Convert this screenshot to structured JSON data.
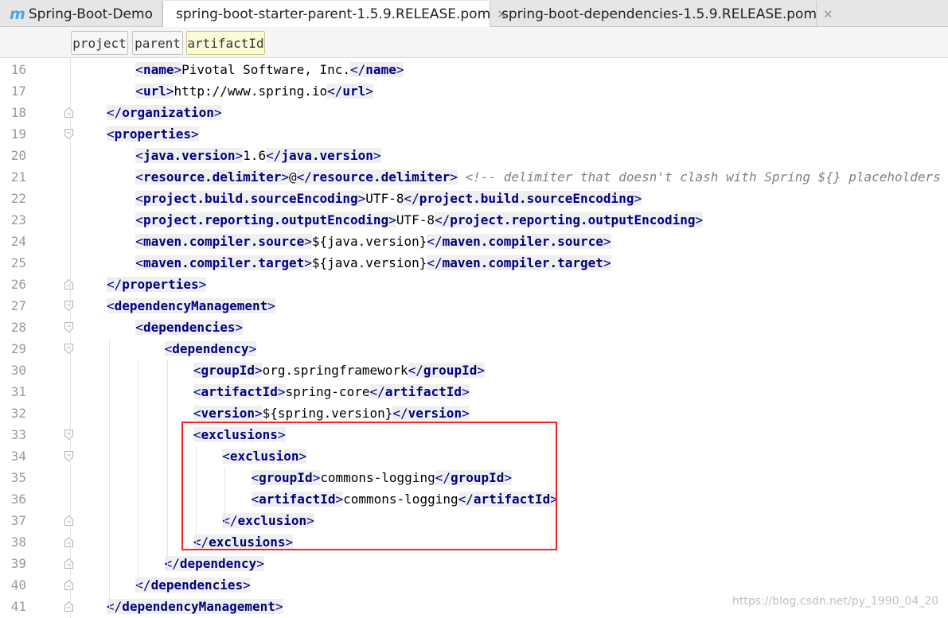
{
  "tabs": [
    {
      "label": "Spring-Boot-Demo",
      "icon": "maven-module-icon",
      "active": false
    },
    {
      "label": "spring-boot-starter-parent-1.5.9.RELEASE.pom",
      "icon": "pom-file-icon",
      "active": true
    },
    {
      "label": "spring-boot-dependencies-1.5.9.RELEASE.pom",
      "icon": "pom-file-icon",
      "active": false
    }
  ],
  "breadcrumb": [
    "project",
    "parent",
    "artifactId"
  ],
  "lines": [
    {
      "num": "16",
      "indent": 2,
      "fold": "",
      "tokens": [
        [
          "o",
          "<"
        ],
        [
          "t",
          "name"
        ],
        [
          "o",
          ">"
        ],
        [
          "x",
          "Pivotal Software, Inc."
        ],
        [
          "o",
          "</"
        ],
        [
          "t",
          "name"
        ],
        [
          "o",
          ">"
        ]
      ]
    },
    {
      "num": "17",
      "indent": 2,
      "fold": "",
      "tokens": [
        [
          "o",
          "<"
        ],
        [
          "t",
          "url"
        ],
        [
          "o",
          ">"
        ],
        [
          "x",
          "http://www.spring.io"
        ],
        [
          "o",
          "</"
        ],
        [
          "t",
          "url"
        ],
        [
          "o",
          ">"
        ]
      ]
    },
    {
      "num": "18",
      "indent": 1,
      "fold": "end",
      "tokens": [
        [
          "o",
          "</"
        ],
        [
          "t",
          "organization"
        ],
        [
          "o",
          ">"
        ]
      ]
    },
    {
      "num": "19",
      "indent": 1,
      "fold": "start",
      "tokens": [
        [
          "o",
          "<"
        ],
        [
          "t",
          "properties"
        ],
        [
          "o",
          ">"
        ]
      ]
    },
    {
      "num": "20",
      "indent": 2,
      "fold": "",
      "tokens": [
        [
          "o",
          "<"
        ],
        [
          "t",
          "java.version"
        ],
        [
          "o",
          ">"
        ],
        [
          "x",
          "1.6"
        ],
        [
          "o",
          "</"
        ],
        [
          "t",
          "java.version"
        ],
        [
          "o",
          ">"
        ]
      ]
    },
    {
      "num": "21",
      "indent": 2,
      "fold": "",
      "tokens": [
        [
          "o",
          "<"
        ],
        [
          "t",
          "resource.delimiter"
        ],
        [
          "o",
          ">"
        ],
        [
          "x",
          "@"
        ],
        [
          "o",
          "</"
        ],
        [
          "t",
          "resource.delimiter"
        ],
        [
          "o",
          ">"
        ],
        [
          "s",
          " "
        ],
        [
          "c",
          "<!-- delimiter that doesn't clash with Spring ${} placeholders -->"
        ]
      ]
    },
    {
      "num": "22",
      "indent": 2,
      "fold": "",
      "tokens": [
        [
          "o",
          "<"
        ],
        [
          "t",
          "project.build.sourceEncoding"
        ],
        [
          "o",
          ">"
        ],
        [
          "x",
          "UTF-8"
        ],
        [
          "o",
          "</"
        ],
        [
          "t",
          "project.build.sourceEncoding"
        ],
        [
          "o",
          ">"
        ]
      ]
    },
    {
      "num": "23",
      "indent": 2,
      "fold": "",
      "tokens": [
        [
          "o",
          "<"
        ],
        [
          "t",
          "project.reporting.outputEncoding"
        ],
        [
          "o",
          ">"
        ],
        [
          "x",
          "UTF-8"
        ],
        [
          "o",
          "</"
        ],
        [
          "t",
          "project.reporting.outputEncoding"
        ],
        [
          "o",
          ">"
        ]
      ]
    },
    {
      "num": "24",
      "indent": 2,
      "fold": "",
      "tokens": [
        [
          "o",
          "<"
        ],
        [
          "t",
          "maven.compiler.source"
        ],
        [
          "o",
          ">"
        ],
        [
          "x",
          "${java.version}"
        ],
        [
          "o",
          "</"
        ],
        [
          "t",
          "maven.compiler.source"
        ],
        [
          "o",
          ">"
        ]
      ]
    },
    {
      "num": "25",
      "indent": 2,
      "fold": "",
      "tokens": [
        [
          "o",
          "<"
        ],
        [
          "t",
          "maven.compiler.target"
        ],
        [
          "o",
          ">"
        ],
        [
          "x",
          "${java.version}"
        ],
        [
          "o",
          "</"
        ],
        [
          "t",
          "maven.compiler.target"
        ],
        [
          "o",
          ">"
        ]
      ]
    },
    {
      "num": "26",
      "indent": 1,
      "fold": "end",
      "tokens": [
        [
          "o",
          "</"
        ],
        [
          "t",
          "properties"
        ],
        [
          "o",
          ">"
        ]
      ]
    },
    {
      "num": "27",
      "indent": 1,
      "fold": "start",
      "tokens": [
        [
          "o",
          "<"
        ],
        [
          "t",
          "dependencyManagement"
        ],
        [
          "o",
          ">"
        ]
      ]
    },
    {
      "num": "28",
      "indent": 2,
      "fold": "start",
      "tokens": [
        [
          "o",
          "<"
        ],
        [
          "t",
          "dependencies"
        ],
        [
          "o",
          ">"
        ]
      ]
    },
    {
      "num": "29",
      "indent": 3,
      "fold": "start",
      "tokens": [
        [
          "o",
          "<"
        ],
        [
          "t",
          "dependency"
        ],
        [
          "o",
          ">"
        ]
      ]
    },
    {
      "num": "30",
      "indent": 4,
      "fold": "",
      "tokens": [
        [
          "o",
          "<"
        ],
        [
          "t",
          "groupId"
        ],
        [
          "o",
          ">"
        ],
        [
          "x",
          "org.springframework"
        ],
        [
          "o",
          "</"
        ],
        [
          "t",
          "groupId"
        ],
        [
          "o",
          ">"
        ]
      ]
    },
    {
      "num": "31",
      "indent": 4,
      "fold": "",
      "tokens": [
        [
          "o",
          "<"
        ],
        [
          "t",
          "artifactId"
        ],
        [
          "o",
          ">"
        ],
        [
          "x",
          "spring-core"
        ],
        [
          "o",
          "</"
        ],
        [
          "t",
          "artifactId"
        ],
        [
          "o",
          ">"
        ]
      ]
    },
    {
      "num": "32",
      "indent": 4,
      "fold": "",
      "tokens": [
        [
          "o",
          "<"
        ],
        [
          "t",
          "version"
        ],
        [
          "o",
          ">"
        ],
        [
          "x",
          "${spring.version}"
        ],
        [
          "o",
          "</"
        ],
        [
          "t",
          "version"
        ],
        [
          "o",
          ">"
        ]
      ]
    },
    {
      "num": "33",
      "indent": 4,
      "fold": "start",
      "tokens": [
        [
          "o",
          "<"
        ],
        [
          "t",
          "exclusions"
        ],
        [
          "o",
          ">"
        ]
      ]
    },
    {
      "num": "34",
      "indent": 5,
      "fold": "start",
      "tokens": [
        [
          "o",
          "<"
        ],
        [
          "t",
          "exclusion"
        ],
        [
          "o",
          ">"
        ]
      ]
    },
    {
      "num": "35",
      "indent": 6,
      "fold": "",
      "tokens": [
        [
          "o",
          "<"
        ],
        [
          "t",
          "groupId"
        ],
        [
          "o",
          ">"
        ],
        [
          "x",
          "commons-logging"
        ],
        [
          "o",
          "</"
        ],
        [
          "t",
          "groupId"
        ],
        [
          "o",
          ">"
        ]
      ]
    },
    {
      "num": "36",
      "indent": 6,
      "fold": "",
      "tokens": [
        [
          "o",
          "<"
        ],
        [
          "t",
          "artifactId"
        ],
        [
          "o",
          ">"
        ],
        [
          "x",
          "commons-logging"
        ],
        [
          "o",
          "</"
        ],
        [
          "t",
          "artifactId"
        ],
        [
          "o",
          ">"
        ]
      ]
    },
    {
      "num": "37",
      "indent": 5,
      "fold": "end",
      "tokens": [
        [
          "o",
          "</"
        ],
        [
          "t",
          "exclusion"
        ],
        [
          "o",
          ">"
        ]
      ]
    },
    {
      "num": "38",
      "indent": 4,
      "fold": "end",
      "tokens": [
        [
          "o",
          "</"
        ],
        [
          "t",
          "exclusions"
        ],
        [
          "o",
          ">"
        ]
      ]
    },
    {
      "num": "39",
      "indent": 3,
      "fold": "end",
      "tokens": [
        [
          "o",
          "</"
        ],
        [
          "t",
          "dependency"
        ],
        [
          "o",
          ">"
        ]
      ]
    },
    {
      "num": "40",
      "indent": 2,
      "fold": "end",
      "tokens": [
        [
          "o",
          "</"
        ],
        [
          "t",
          "dependencies"
        ],
        [
          "o",
          ">"
        ]
      ]
    },
    {
      "num": "41",
      "indent": 1,
      "fold": "end",
      "tokens": [
        [
          "o",
          "</"
        ],
        [
          "t",
          "dependencyManagement"
        ],
        [
          "o",
          ">"
        ]
      ]
    }
  ],
  "watermark": "https://blog.csdn.net/py_1990_04_20",
  "colors": {
    "tag": "#000080",
    "comment": "#808080",
    "highlight": "#ff2020"
  }
}
